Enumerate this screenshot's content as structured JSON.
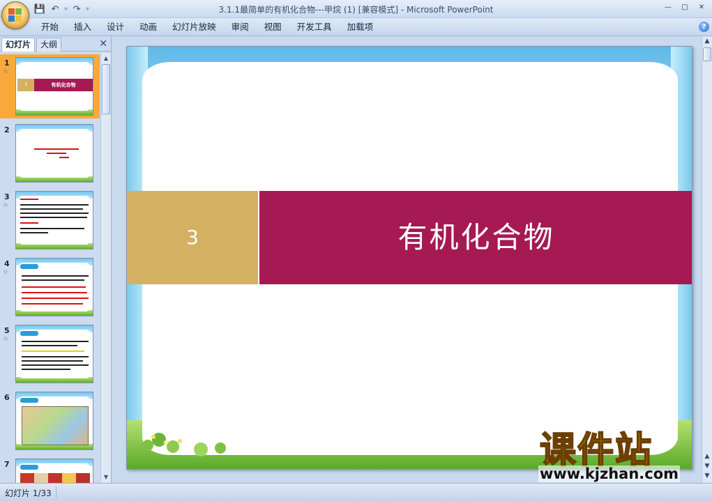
{
  "window": {
    "title": "3.1.1最简单的有机化合物---甲烷 (1) [兼容模式] - Microsoft PowerPoint",
    "controls": [
      "—",
      "□",
      "✕"
    ]
  },
  "quick_access": {
    "save_icon": "💾",
    "undo_icon": "↶",
    "redo_icon": "↷",
    "customize_icon": "▾"
  },
  "ribbon": {
    "tabs": [
      "开始",
      "插入",
      "设计",
      "动画",
      "幻灯片放映",
      "审阅",
      "视图",
      "开发工具",
      "加载项"
    ],
    "help_label": "?"
  },
  "left_pane": {
    "tab_slides": "幻灯片",
    "tab_outline": "大纲",
    "close_label": "✕",
    "anim_marker": "☆",
    "thumbnails": [
      {
        "num": "1",
        "has_anim": true,
        "selected": true,
        "title": "有机化合物",
        "badge": "3"
      },
      {
        "num": "2",
        "has_anim": false,
        "selected": false
      },
      {
        "num": "3",
        "has_anim": true,
        "selected": false
      },
      {
        "num": "4",
        "has_anim": true,
        "selected": false
      },
      {
        "num": "5",
        "has_anim": true,
        "selected": false
      },
      {
        "num": "6",
        "has_anim": false,
        "selected": false
      },
      {
        "num": "7",
        "has_anim": false,
        "selected": false
      }
    ]
  },
  "slide": {
    "number": "3",
    "title": "有机化合物"
  },
  "watermark": {
    "logo": "课件站",
    "url": "www.kjzhan.com"
  },
  "status": {
    "slide_indicator": "幻灯片 1/33"
  }
}
